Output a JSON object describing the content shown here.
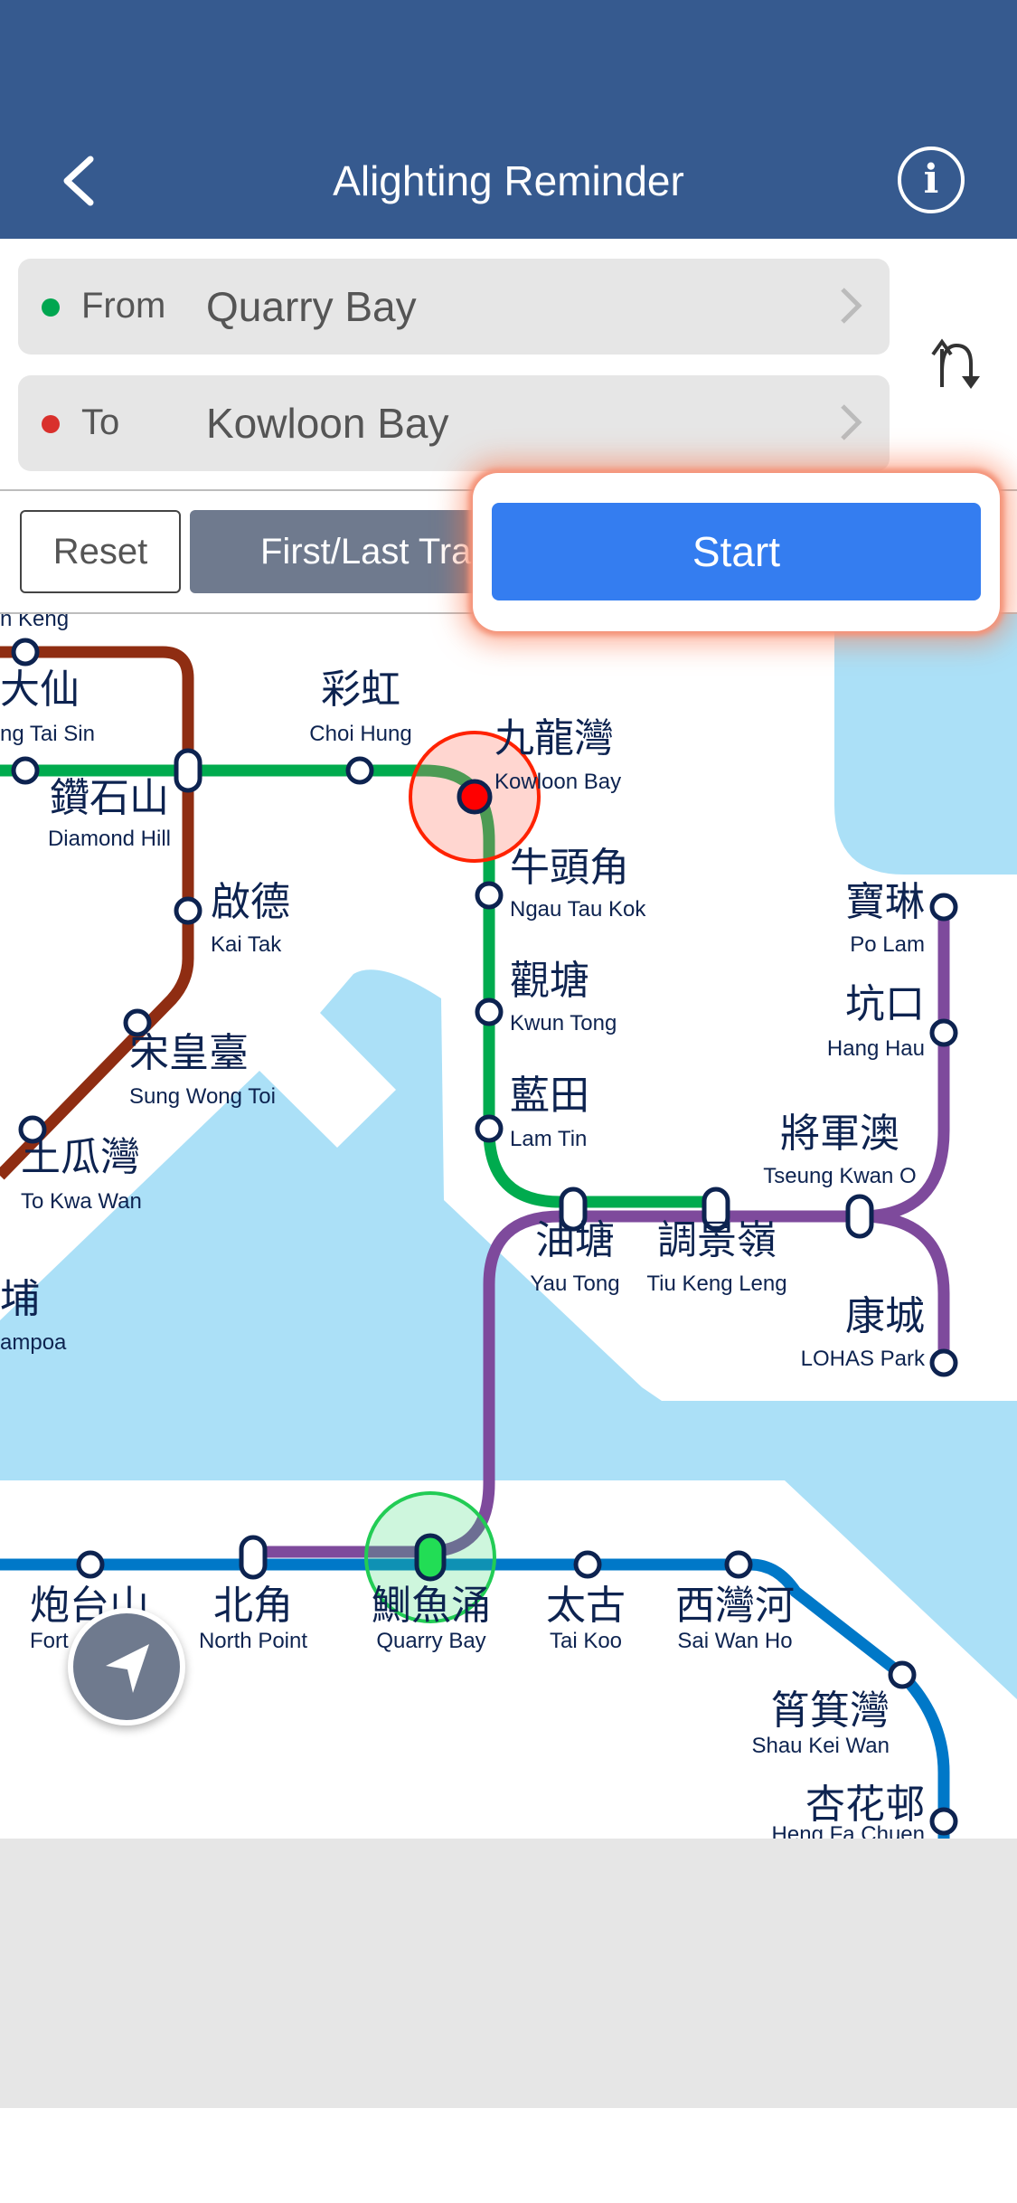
{
  "header": {
    "title": "Alighting Reminder",
    "back_icon": "chevron-left-icon",
    "info_icon": "info-icon"
  },
  "route": {
    "from": {
      "label": "From",
      "value": "Quarry Bay",
      "dot_color": "#00a650"
    },
    "to": {
      "label": "To",
      "value": "Kowloon Bay",
      "dot_color": "#d9302c"
    },
    "swap_icon": "swap-arrows-icon"
  },
  "actions": {
    "reset": "Reset",
    "first_last": "First/Last Train",
    "start": "Start"
  },
  "colors": {
    "header": "#365a8f",
    "start": "#347df0",
    "water": "#abe0f7",
    "line_brown": "#8f2d12",
    "line_green": "#00ab4e",
    "line_purple": "#7e4a9c",
    "line_blue": "#0078c8",
    "origin_highlight": "#22cc55",
    "destination_highlight": "#ff2200"
  },
  "map": {
    "stations": [
      {
        "zh": "",
        "en": "n Keng"
      },
      {
        "zh": "大仙",
        "en": "ng Tai Sin"
      },
      {
        "zh": "彩虹",
        "en": "Choi Hung"
      },
      {
        "zh": "九龍灣",
        "en": "Kowloon Bay"
      },
      {
        "zh": "鑽石山",
        "en": "Diamond Hill"
      },
      {
        "zh": "牛頭角",
        "en": "Ngau Tau Kok"
      },
      {
        "zh": "啟德",
        "en": "Kai Tak"
      },
      {
        "zh": "觀塘",
        "en": "Kwun Tong"
      },
      {
        "zh": "寶琳",
        "en": "Po Lam"
      },
      {
        "zh": "坑口",
        "en": "Hang Hau"
      },
      {
        "zh": "宋皇臺",
        "en": "Sung Wong Toi"
      },
      {
        "zh": "藍田",
        "en": "Lam Tin"
      },
      {
        "zh": "將軍澳",
        "en": "Tseung Kwan O"
      },
      {
        "zh": "土瓜灣",
        "en": "To Kwa Wan"
      },
      {
        "zh": "油塘",
        "en": "Yau Tong"
      },
      {
        "zh": "調景嶺",
        "en": "Tiu Keng Leng"
      },
      {
        "zh": "埔",
        "en": "ampoa"
      },
      {
        "zh": "康城",
        "en": "LOHAS Park"
      },
      {
        "zh": "炮台山",
        "en": "Fort"
      },
      {
        "zh": "北角",
        "en": "North Point"
      },
      {
        "zh": "鰂魚涌",
        "en": "Quarry Bay"
      },
      {
        "zh": "太古",
        "en": "Tai Koo"
      },
      {
        "zh": "西灣河",
        "en": "Sai Wan Ho"
      },
      {
        "zh": "筲箕灣",
        "en": "Shau Kei Wan"
      },
      {
        "zh": "杏花邨",
        "en": "Heng Fa Chuen"
      }
    ],
    "origin": "Quarry Bay",
    "destination": "Kowloon Bay",
    "locate_icon": "location-arrow-icon"
  }
}
